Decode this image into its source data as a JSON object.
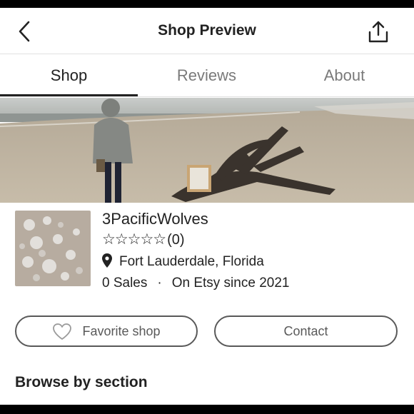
{
  "header": {
    "title": "Shop Preview",
    "back_icon": "chevron-left-icon",
    "share_icon": "share-icon"
  },
  "tabs": [
    {
      "label": "Shop",
      "active": true
    },
    {
      "label": "Reviews",
      "active": false
    },
    {
      "label": "About",
      "active": false
    }
  ],
  "shop": {
    "name": "3PacificWolves",
    "stars": "☆☆☆☆☆",
    "review_count": "(0)",
    "location": "Fort Lauderdale, Florida",
    "sales": "0 Sales",
    "separator": "·",
    "since": "On Etsy since 2021"
  },
  "actions": {
    "favorite_label": "Favorite shop",
    "contact_label": "Contact"
  },
  "sections": {
    "heading": "Browse by section"
  },
  "colors": {
    "text": "#222222",
    "muted": "#7a7a7a",
    "button_border": "#595959"
  }
}
